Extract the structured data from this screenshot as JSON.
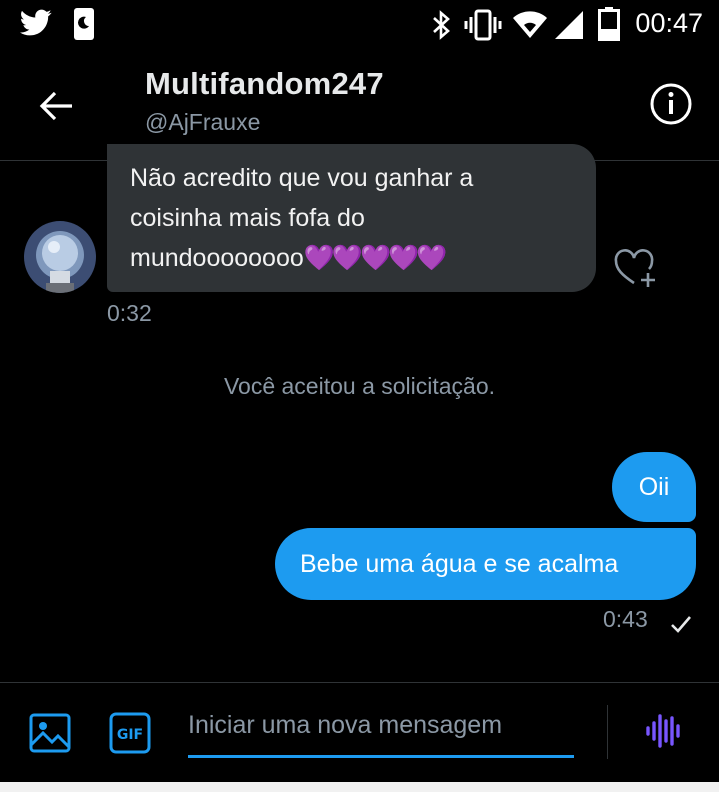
{
  "status_bar": {
    "time": "00:47",
    "icons": [
      "twitter-icon",
      "sim-icon",
      "bluetooth-icon",
      "vibrate-icon",
      "wifi-icon",
      "signal-icon",
      "battery-icon"
    ]
  },
  "header": {
    "title": "Multifandom247",
    "handle": "@AjFrauxe",
    "back_icon": "arrow-left-icon",
    "info_icon": "info-icon"
  },
  "messages": {
    "received": {
      "lines": [
        "Não acredito que vou ganhar a",
        "coisinha mais fofa do"
      ],
      "last_line_text": "mundoooooooo",
      "emoji": "💜💜💜💜💜",
      "time": "0:32"
    },
    "system": "Você aceitou a solicitação.",
    "sent": [
      {
        "text": "Oii"
      },
      {
        "text": "Bebe uma água e se acalma"
      }
    ],
    "sent_time": "0:43"
  },
  "composer": {
    "placeholder": "Iniciar uma nova mensagem",
    "gif_label": "GIF"
  },
  "colors": {
    "accent": "#1d9bf0",
    "received_bubble": "#2f3336",
    "muted_text": "#8b98a5",
    "voice_icon": "#7856ff"
  }
}
